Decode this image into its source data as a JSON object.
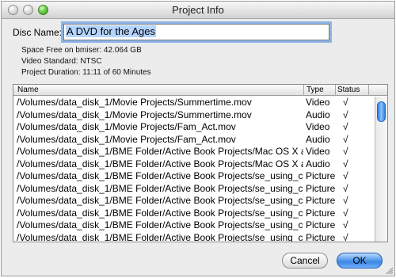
{
  "window": {
    "title": "Project Info"
  },
  "disc": {
    "label": "Disc Name:",
    "value": "A DVD for the Ages"
  },
  "info": {
    "space_free": "Space Free on bmiser: 42.064 GB",
    "video_standard": "Video Standard: NTSC",
    "duration": "Project Duration: 11:11 of 60 Minutes"
  },
  "table": {
    "columns": {
      "name": "Name",
      "type": "Type",
      "status": "Status"
    },
    "rows": [
      {
        "name": "/Volumes/data_disk_1/Movie Projects/Summertime.mov",
        "type": "Video",
        "status": "√"
      },
      {
        "name": "/Volumes/data_disk_1/Movie Projects/Summertime.mov",
        "type": "Audio",
        "status": "√"
      },
      {
        "name": "/Volumes/data_disk_1/Movie Projects/Fam_Act.mov",
        "type": "Video",
        "status": "√"
      },
      {
        "name": "/Volumes/data_disk_1/Movie Projects/Fam_Act.mov",
        "type": "Audio",
        "status": "√"
      },
      {
        "name": "/Volumes/data_disk_1/BME Folder/Active Book Projects/Mac OS X a",
        "type": "Video",
        "status": "√"
      },
      {
        "name": "/Volumes/data_disk_1/BME Folder/Active Book Projects/Mac OS X a",
        "type": "Audio",
        "status": "√"
      },
      {
        "name": "/Volumes/data_disk_1/BME Folder/Active Book Projects/se_using_c",
        "type": "Picture",
        "status": "√"
      },
      {
        "name": "/Volumes/data_disk_1/BME Folder/Active Book Projects/se_using_c",
        "type": "Picture",
        "status": "√"
      },
      {
        "name": "/Volumes/data_disk_1/BME Folder/Active Book Projects/se_using_c",
        "type": "Picture",
        "status": "√"
      },
      {
        "name": "/Volumes/data_disk_1/BME Folder/Active Book Projects/se_using_c",
        "type": "Picture",
        "status": "√"
      },
      {
        "name": "/Volumes/data_disk_1/BME Folder/Active Book Projects/se_using_c",
        "type": "Picture",
        "status": "√"
      },
      {
        "name": "/Volumes/data_disk_1/BME Folder/Active Book Projects/se_using_c",
        "type": "Picture",
        "status": "√"
      }
    ]
  },
  "buttons": {
    "cancel": "Cancel",
    "ok": "OK"
  },
  "colors": {
    "accent": "#3a87e2",
    "focus_ring": "#8db4e7",
    "selection": "#b5d5ff"
  }
}
